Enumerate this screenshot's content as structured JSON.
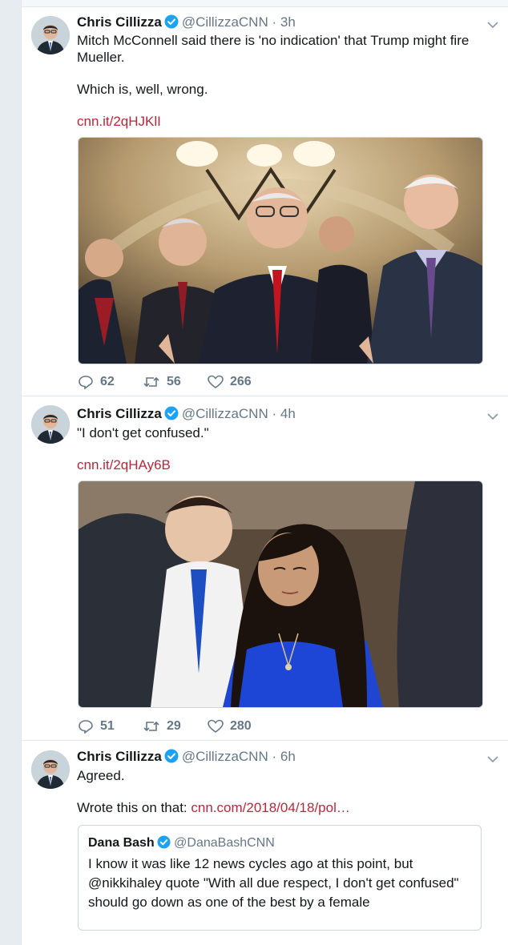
{
  "tweets": [
    {
      "author": "Chris Cillizza",
      "handle": "@CillizzaCNN",
      "time": "3h",
      "text_lines": [
        "Mitch McConnell said there is 'no indication' that Trump might fire Mueller.",
        "Which is, well, wrong."
      ],
      "link": "cnn.it/2qHJKlI",
      "replies": "62",
      "retweets": "56",
      "likes": "266"
    },
    {
      "author": "Chris Cillizza",
      "handle": "@CillizzaCNN",
      "time": "4h",
      "text_lines": [
        "\"I don't get confused.\""
      ],
      "link": "cnn.it/2qHAy6B",
      "replies": "51",
      "retweets": "29",
      "likes": "280"
    },
    {
      "author": "Chris Cillizza",
      "handle": "@CillizzaCNN",
      "time": "6h",
      "text_lines": [
        "Agreed.",
        "Wrote this on that:"
      ],
      "link": "cnn.com/2018/04/18/pol…",
      "quote": {
        "author": "Dana Bash",
        "handle": "@DanaBashCNN",
        "text": "I know it was like 12 news cycles ago at this point, but @nikkihaley quote \"With all due respect, I don't get confused\" should go down as one of the best by a female"
      }
    }
  ],
  "separator": "·",
  "icons": {
    "reply": "reply-icon",
    "retweet": "retweet-icon",
    "like": "heart-icon",
    "verified": "verified-badge-icon",
    "menu": "chevron-down-icon"
  },
  "colors": {
    "link": "#b4293a",
    "secondary": "#657786",
    "verified": "#1da1f2",
    "border": "#e1e8ed"
  }
}
